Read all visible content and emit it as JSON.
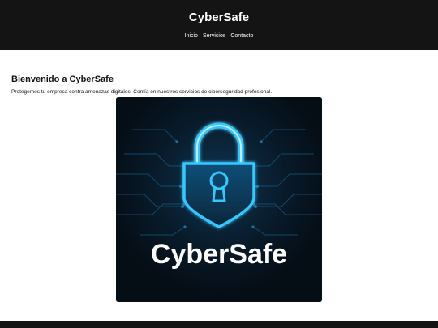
{
  "header": {
    "title": "CyberSafe",
    "nav": [
      "Inicio",
      "Servicios",
      "Contacto"
    ]
  },
  "main": {
    "heading": "Bienvenido a CyberSafe",
    "intro": "Protegemos tu empresa contra amenazas digitales. Confía en nuestros servicios de ciberseguridad profesional."
  },
  "hero": {
    "brand_text": "CyberSafe",
    "icon": "padlock-icon"
  },
  "colors": {
    "header_bg": "#141414",
    "hero_bg": "#06121d",
    "neon": "#39c6ff"
  }
}
